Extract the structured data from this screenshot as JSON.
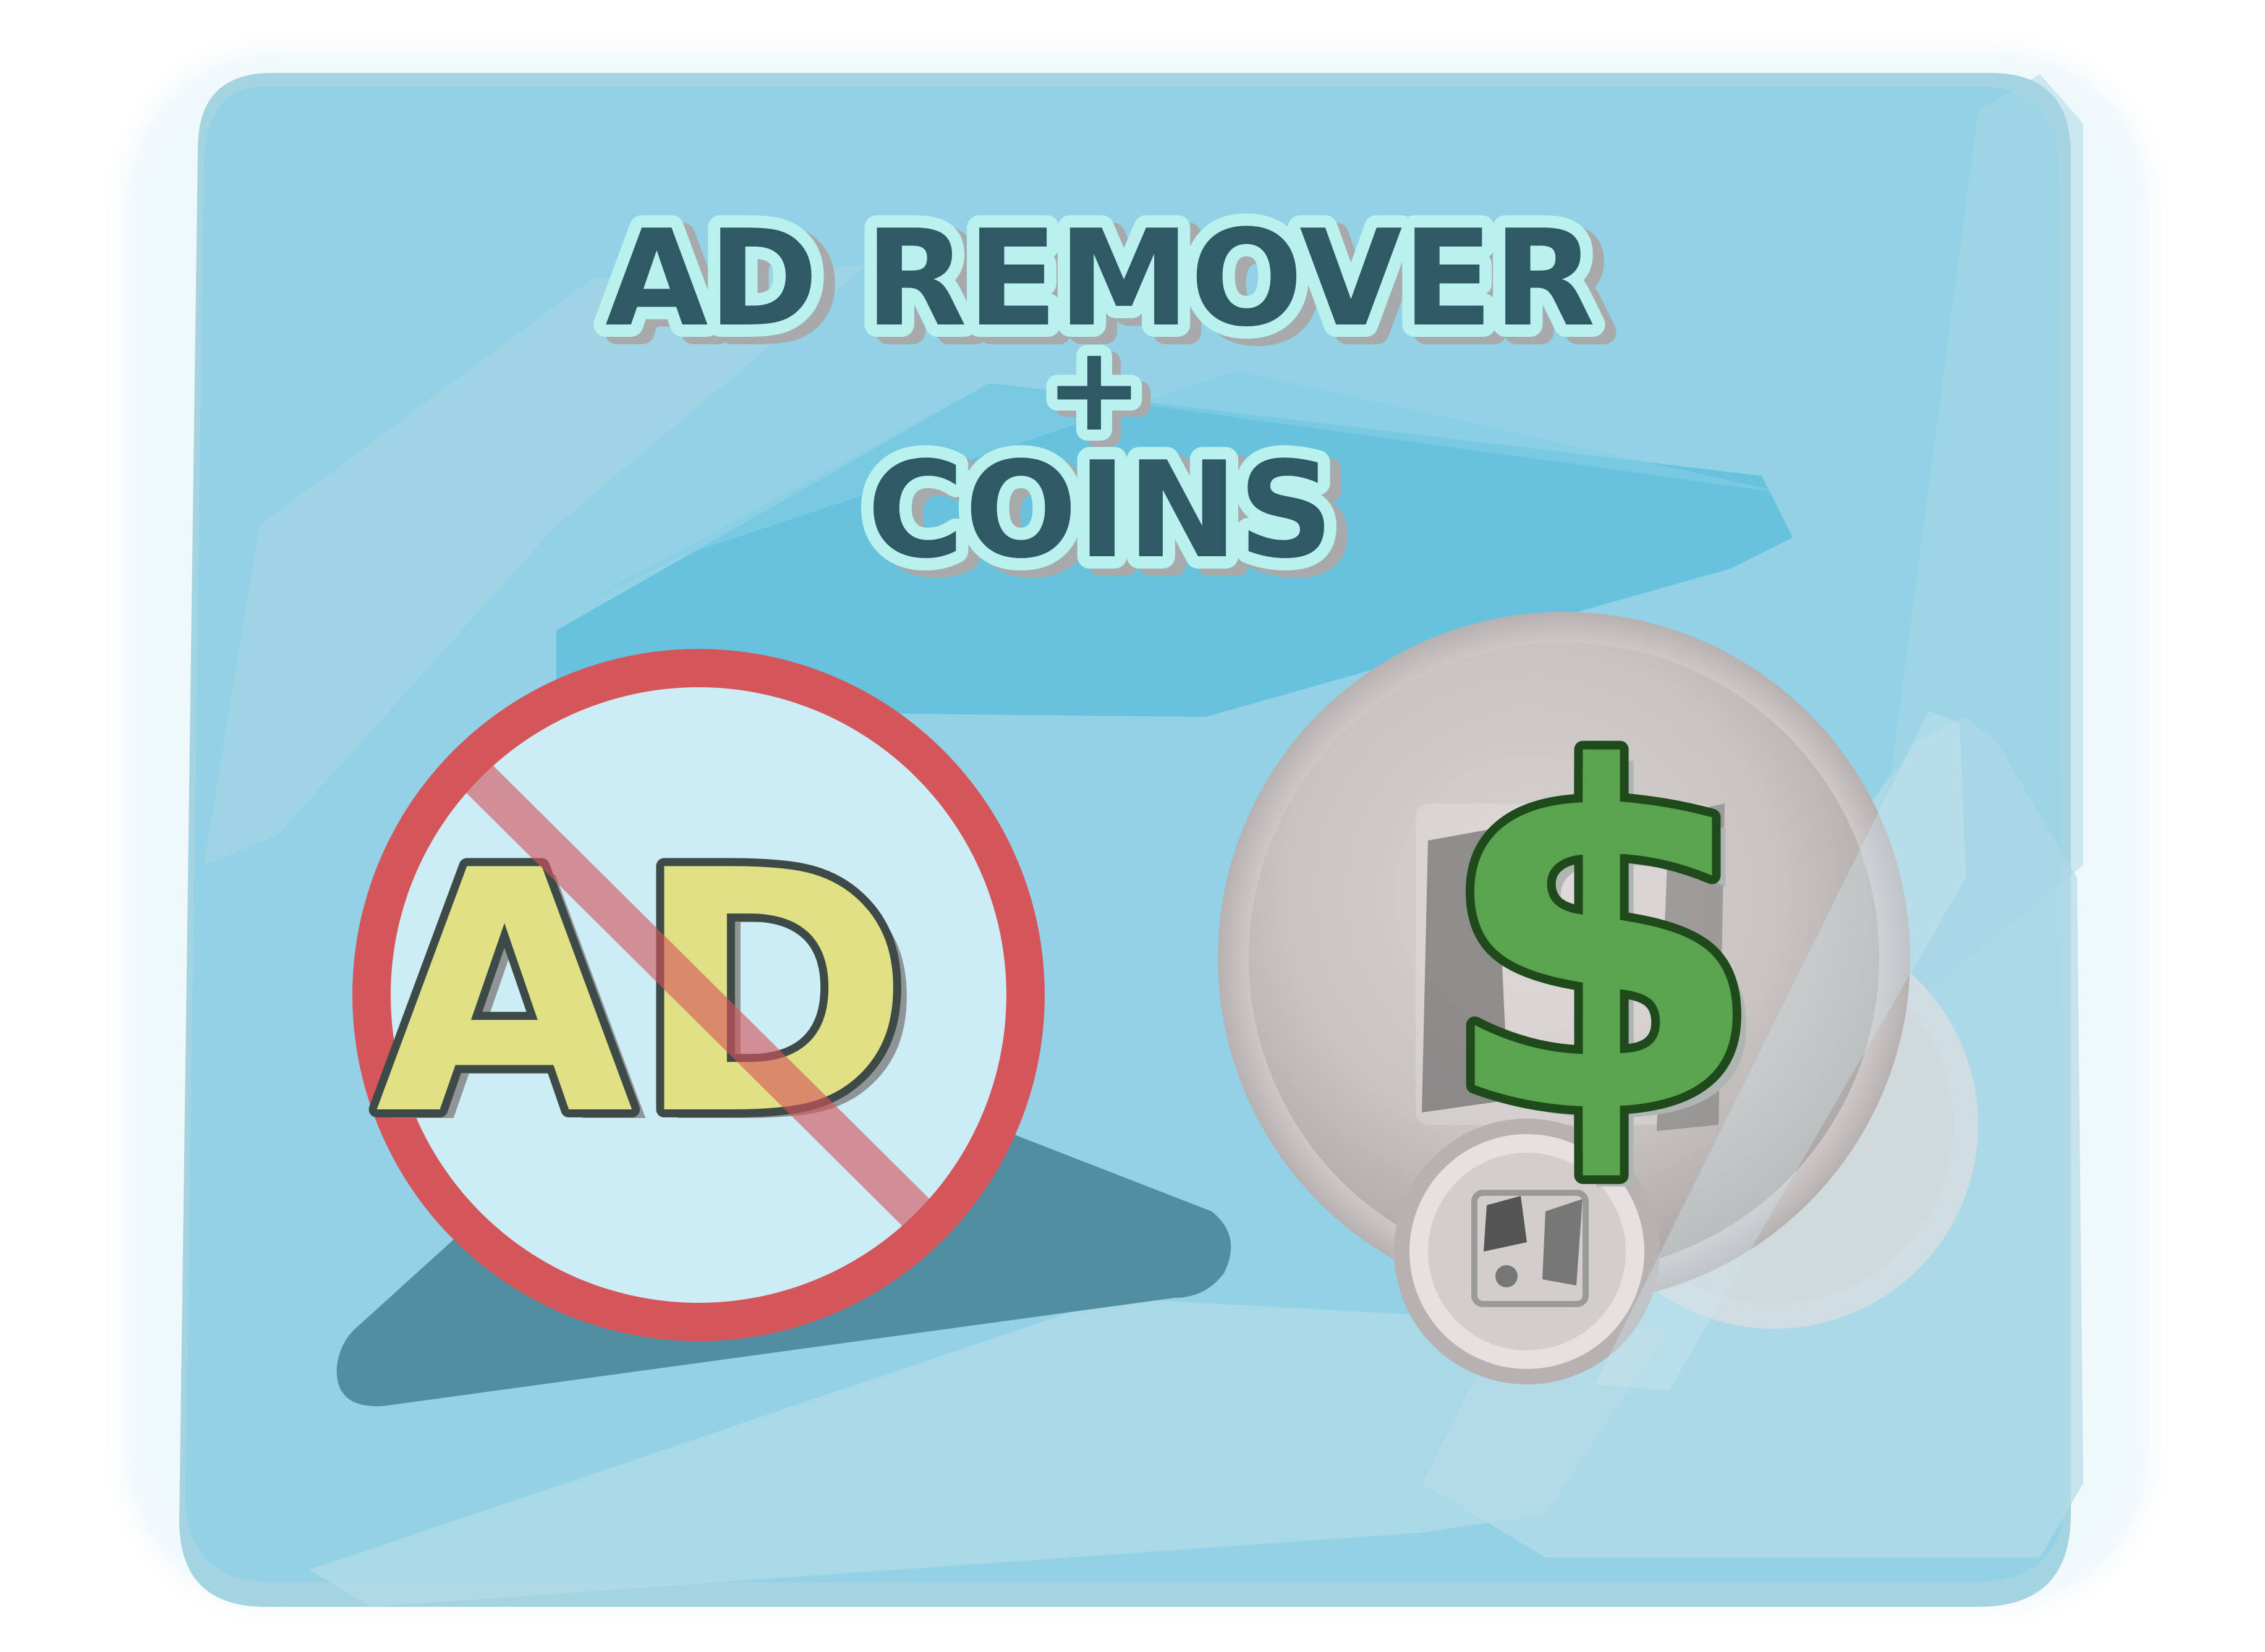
{
  "card": {
    "title_line1": "AD REMOVER",
    "title_plus": "+",
    "title_line2": "COINS"
  },
  "no_ads_badge": {
    "label": "AD",
    "icon": "prohibited-sign-icon"
  },
  "coins_badge": {
    "label": "$",
    "icon": "silver-coin-icon"
  },
  "colors": {
    "card_blue": "#93d2e6",
    "title_fill": "#2f5965",
    "title_outline": "#b8f1ee",
    "prohibit_red": "#d4565a",
    "ad_yellow": "#e0e085",
    "dollar_green": "#5aa44f",
    "coin_silver": "#cfc9c8"
  }
}
